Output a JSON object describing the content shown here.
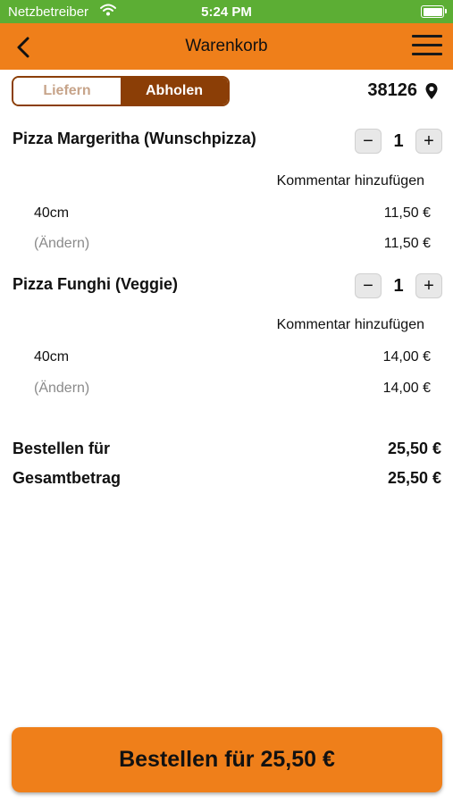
{
  "status_bar": {
    "carrier": "Netzbetreiber",
    "time": "5:24 PM"
  },
  "nav": {
    "title": "Warenkorb",
    "back_icon": "chevron-left-icon",
    "menu_icon": "hamburger-menu-icon"
  },
  "delivery_toggle": {
    "options": [
      "Liefern",
      "Abholen"
    ],
    "selected": "Abholen"
  },
  "location": {
    "zip": "38126",
    "icon": "map-pin-icon"
  },
  "cart_items": [
    {
      "name": "Pizza Margeritha (Wunschpizza)",
      "quantity": "1",
      "minus": "−",
      "plus": "+",
      "comment_label": "Kommentar hinzufügen",
      "size": "40cm",
      "size_price": "11,50 €",
      "change_label": "(Ändern)",
      "item_price": "11,50 €"
    },
    {
      "name": "Pizza Funghi (Veggie)",
      "quantity": "1",
      "minus": "−",
      "plus": "+",
      "comment_label": "Kommentar hinzufügen",
      "size": "40cm",
      "size_price": "14,00 €",
      "change_label": "(Ändern)",
      "item_price": "14,00 €"
    }
  ],
  "totals": {
    "order_for_label": "Bestellen für",
    "order_for_value": "25,50 €",
    "total_label": "Gesamtbetrag",
    "total_value": "25,50 €"
  },
  "order_button": {
    "label": "Bestellen für 25,50 €"
  },
  "colors": {
    "brand_orange": "#ef7f1a",
    "status_green": "#5cae34",
    "toggle_brown": "#8b3e06"
  }
}
